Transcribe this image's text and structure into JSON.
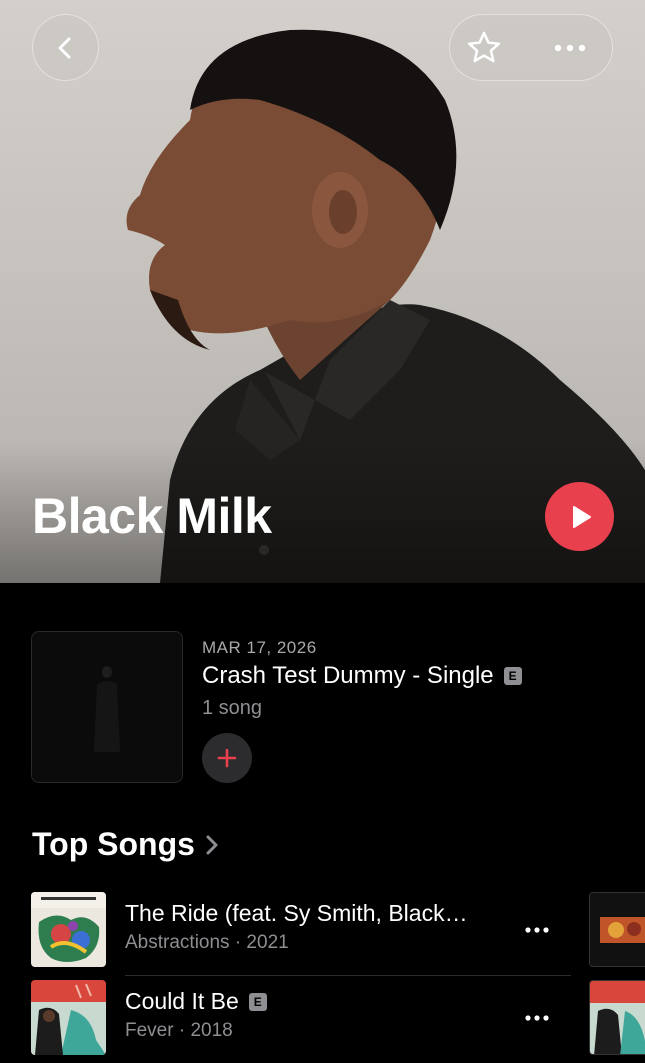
{
  "artist": {
    "name": "Black Milk"
  },
  "hero": {
    "back_icon": "chevron-left-icon",
    "favorite_icon": "star-outline-icon",
    "more_icon": "ellipsis-icon",
    "play_icon": "play-icon",
    "accent_color": "#e8404d"
  },
  "latest_release": {
    "date": "MAR 17, 2026",
    "title": "Crash Test Dummy - Single",
    "explicit_badge": "E",
    "subtitle": "1 song",
    "add_icon": "plus-icon"
  },
  "top_songs": {
    "title": "Top Songs",
    "chevron_icon": "chevron-right-icon",
    "items": [
      {
        "title": "The Ride (feat. Sy Smith, Black…",
        "meta": "Abstractions · 2021",
        "explicit": false
      },
      {
        "title": "Could It Be",
        "explicit_badge": "E",
        "meta": "Fever · 2018",
        "explicit": true
      }
    ]
  }
}
